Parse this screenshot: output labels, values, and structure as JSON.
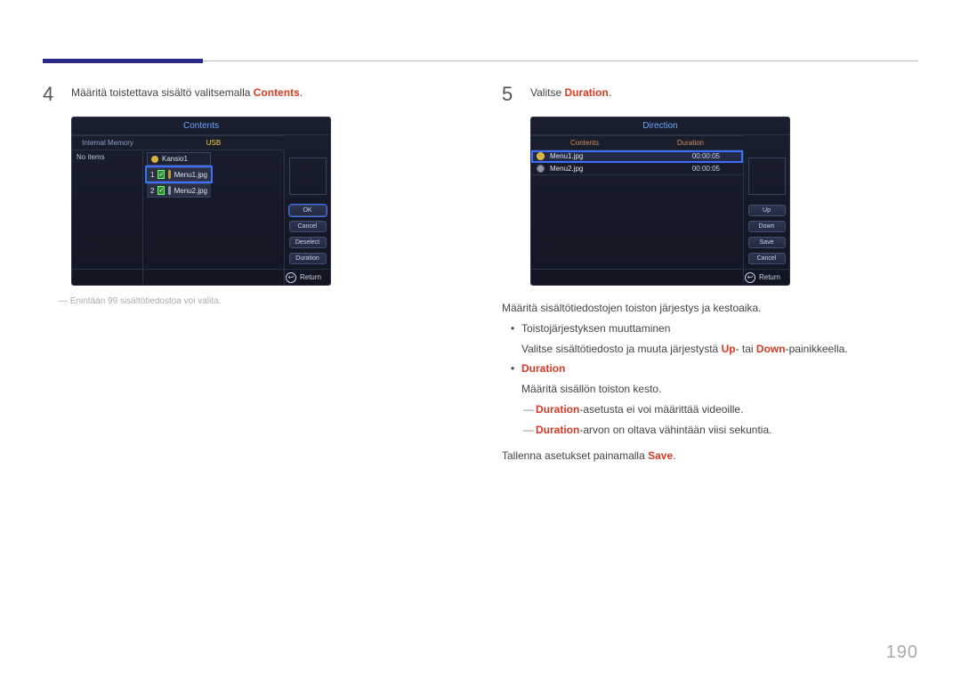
{
  "page_number": "190",
  "step4": {
    "num": "4",
    "text_pre": "Määritä toistettava sisältö valitsemalla ",
    "kw": "Contents",
    "suffix": ".",
    "note": "Enintään 99 sisältötiedostoa voi valita.",
    "panel": {
      "title": "Contents",
      "tab_left": "Internal Memory",
      "tab_right": "USB",
      "left_msg": "No items",
      "category": "Kansio1",
      "rows": [
        {
          "idx": "1",
          "name": "Menu1.jpg",
          "sel": true
        },
        {
          "idx": "2",
          "name": "Menu2.jpg",
          "sel": false
        }
      ],
      "buttons": [
        "OK",
        "Cancel",
        "Deselect",
        "Duration"
      ],
      "return": "Return"
    }
  },
  "step5": {
    "num": "5",
    "text_pre": "Valitse ",
    "kw": "Duration",
    "suffix": ".",
    "panel": {
      "title": "Direction",
      "col_left": "Contents",
      "col_right": "Duration",
      "rows": [
        {
          "name": "Menu1.jpg",
          "dur": "00:00:05",
          "sel": true
        },
        {
          "name": "Menu2.jpg",
          "dur": "00:00:05",
          "sel": false
        }
      ],
      "buttons": [
        "Up",
        "Down",
        "Save",
        "Cancel"
      ],
      "return": "Return"
    },
    "body": {
      "intro": "Määritä sisältötiedostojen toiston järjestys ja kestoaika.",
      "b1": "Toistojärjestyksen muuttaminen",
      "b1_sub_pre": "Valitse sisältötiedosto ja muuta järjestystä ",
      "up": "Up",
      "mid": "- tai ",
      "down": "Down",
      "b1_sub_post": "-painikkeella.",
      "b2": "Duration",
      "b2_sub": "Määritä sisällön toiston kesto.",
      "d1_kw": "Duration",
      "d1_rest": "-asetusta ei voi määrittää videoille.",
      "d2_kw": "Duration",
      "d2_rest": "-arvon on oltava vähintään viisi sekuntia.",
      "save_pre": "Tallenna asetukset painamalla ",
      "save_kw": "Save",
      "save_post": "."
    }
  }
}
